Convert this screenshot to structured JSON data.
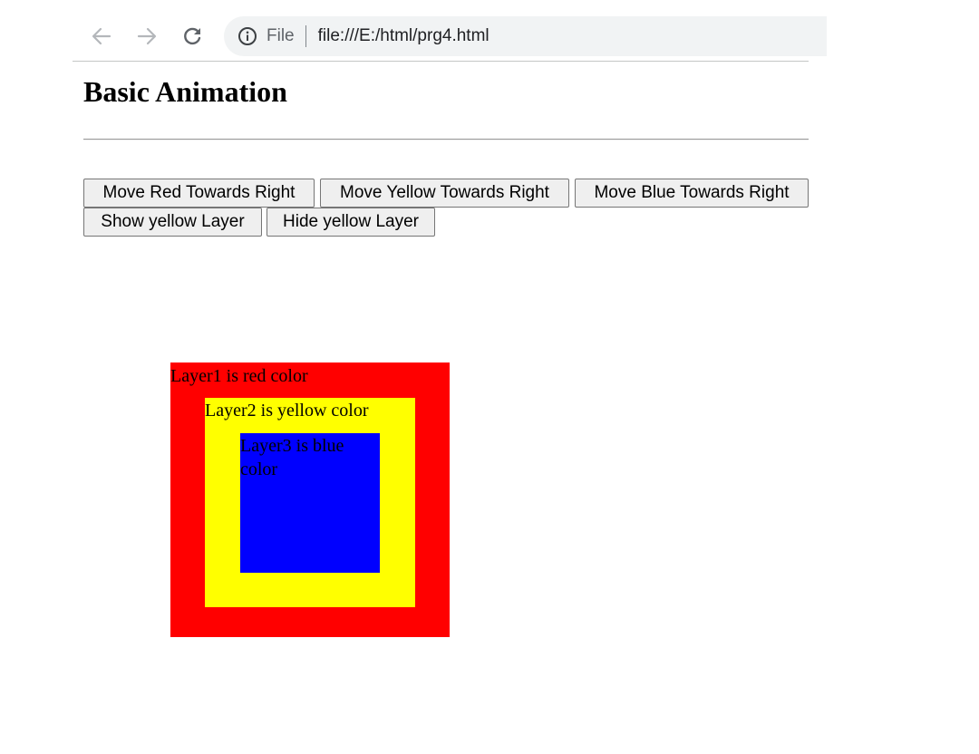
{
  "browser": {
    "scheme_label": "File",
    "url": "file:///E:/html/prg4.html",
    "icons": {
      "back": "arrow-left",
      "forward": "arrow-right",
      "reload": "circular-arrow",
      "site_info": "info-circle"
    }
  },
  "page": {
    "title": "Basic Animation",
    "buttons": {
      "move_red": "Move Red Towards Right",
      "move_yellow": "Move Yellow Towards Right",
      "move_blue": "Move Blue Towards Right",
      "show_yellow": "Show yellow Layer",
      "hide_yellow": "Hide yellow Layer"
    },
    "layers": {
      "red": {
        "label": "Layer1 is red color",
        "color": "#ff0000"
      },
      "yellow": {
        "label": "Layer2 is yellow color",
        "color": "#ffff00"
      },
      "blue": {
        "label": "Layer3 is blue color",
        "color": "#0000ff"
      }
    }
  }
}
